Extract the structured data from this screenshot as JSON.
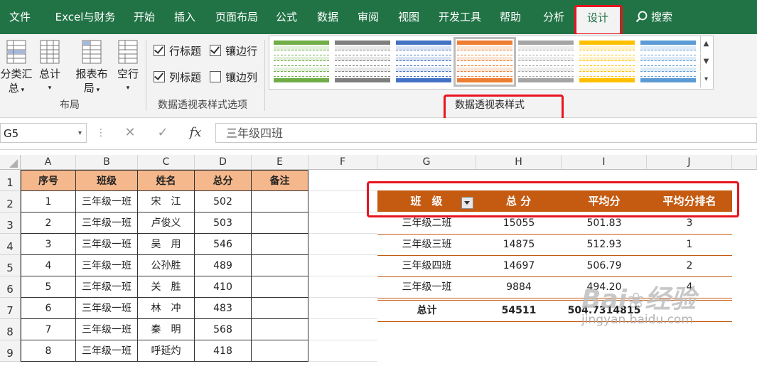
{
  "ribbon_tabs": [
    "文件",
    "Excel与财务",
    "开始",
    "插入",
    "页面布局",
    "公式",
    "数据",
    "审阅",
    "视图",
    "开发工具",
    "帮助",
    "分析",
    "设计"
  ],
  "search_label": "搜索",
  "layout_group": {
    "buttons": [
      {
        "label_line1": "分类汇",
        "label_line2": "总"
      },
      {
        "label_line1": "总计",
        "label_line2": ""
      },
      {
        "label_line1": "报表布",
        "label_line2": "局"
      },
      {
        "label_line1": "空行",
        "label_line2": ""
      }
    ],
    "group_label": "布局"
  },
  "style_options": {
    "checkboxes": [
      {
        "label": "行标题",
        "checked": true
      },
      {
        "label": "镶边行",
        "checked": true
      },
      {
        "label": "列标题",
        "checked": true
      },
      {
        "label": "镶边列",
        "checked": false
      }
    ],
    "group_label": "数据透视表样式选项"
  },
  "styles_group_label": "数据透视表样式",
  "style_swatches": [
    {
      "color": "#70ad47",
      "light": "#e2efda"
    },
    {
      "color": "#7f7f7f",
      "light": "#e8e8e8"
    },
    {
      "color": "#4472c4",
      "light": "#dae3f3"
    },
    {
      "color": "#ed7d31",
      "light": "#fbe5d6"
    },
    {
      "color": "#a5a5a5",
      "light": "#ededed"
    },
    {
      "color": "#ffc000",
      "light": "#fff2cc"
    },
    {
      "color": "#5b9bd5",
      "light": "#ddebf7"
    }
  ],
  "name_box": "G5",
  "formula_value": "三年级四班",
  "columns": [
    "A",
    "B",
    "C",
    "D",
    "E",
    "F",
    "G",
    "H",
    "I",
    "J"
  ],
  "rows": [
    "1",
    "2",
    "3",
    "4",
    "5",
    "6",
    "7",
    "8",
    "9"
  ],
  "table": {
    "headers": [
      "序号",
      "班级",
      "姓名",
      "总分",
      "备注"
    ],
    "rows": [
      [
        "1",
        "三年级一班",
        "宋　江",
        "502",
        ""
      ],
      [
        "2",
        "三年级一班",
        "卢俊义",
        "503",
        ""
      ],
      [
        "3",
        "三年级一班",
        "吴　用",
        "546",
        ""
      ],
      [
        "4",
        "三年级一班",
        "公孙胜",
        "489",
        ""
      ],
      [
        "5",
        "三年级一班",
        "关　胜",
        "410",
        ""
      ],
      [
        "6",
        "三年级一班",
        "林　冲",
        "483",
        ""
      ],
      [
        "7",
        "三年级一班",
        "秦　明",
        "568",
        ""
      ],
      [
        "8",
        "三年级一班",
        "呼延灼",
        "418",
        ""
      ]
    ]
  },
  "pivot": {
    "headers": [
      "班　级",
      "总 分",
      "平均分",
      "平均分排名"
    ],
    "rows": [
      [
        "三年级二班",
        "15055",
        "501.83",
        "3"
      ],
      [
        "三年级三班",
        "14875",
        "512.93",
        "1"
      ],
      [
        "三年级四班",
        "14697",
        "506.79",
        "2"
      ],
      [
        "三年级一班",
        "9884",
        "494.20",
        "4"
      ]
    ],
    "total": [
      "总计",
      "54511",
      "504.7314815"
    ]
  },
  "watermark": {
    "text1": "Bai",
    "text2": "经验",
    "url": "jingyan.baidu.com"
  },
  "colors": {
    "excel_green": "#217346",
    "pivot_header": "#c55a11",
    "table_header": "#f5b88c",
    "highlight_red": "#e8141e"
  }
}
